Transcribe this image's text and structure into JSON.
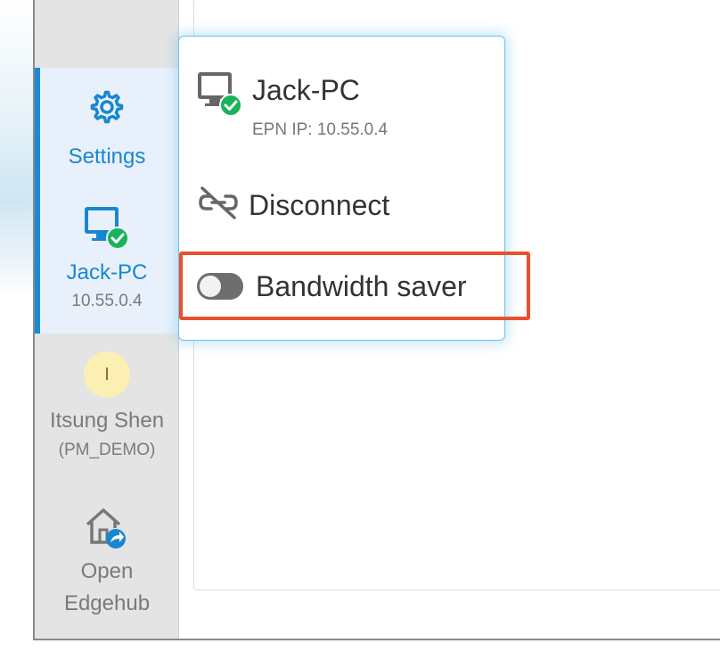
{
  "sidebar": {
    "settings_label": "Settings",
    "device_name": "Jack-PC",
    "device_ip": "10.55.0.4",
    "user_initial": "I",
    "user_name": "Itsung Shen",
    "user_org": "(PM_DEMO)",
    "edgehub_line1": "Open",
    "edgehub_line2": "Edgehub"
  },
  "popup": {
    "device_name": "Jack-PC",
    "device_ip": "EPN IP: 10.55.0.4",
    "disconnect_label": "Disconnect",
    "bandwidth_label": "Bandwidth saver",
    "bandwidth_saver_on": false
  },
  "colors": {
    "accent": "#1a8ad6",
    "online": "#19b35c",
    "highlight": "#e8502e",
    "popup_border": "#6cc3ea"
  },
  "icons": {
    "settings": "gear-icon",
    "device": "monitor-check-icon",
    "disconnect": "link-off-icon",
    "edgehub": "home-share-icon"
  }
}
